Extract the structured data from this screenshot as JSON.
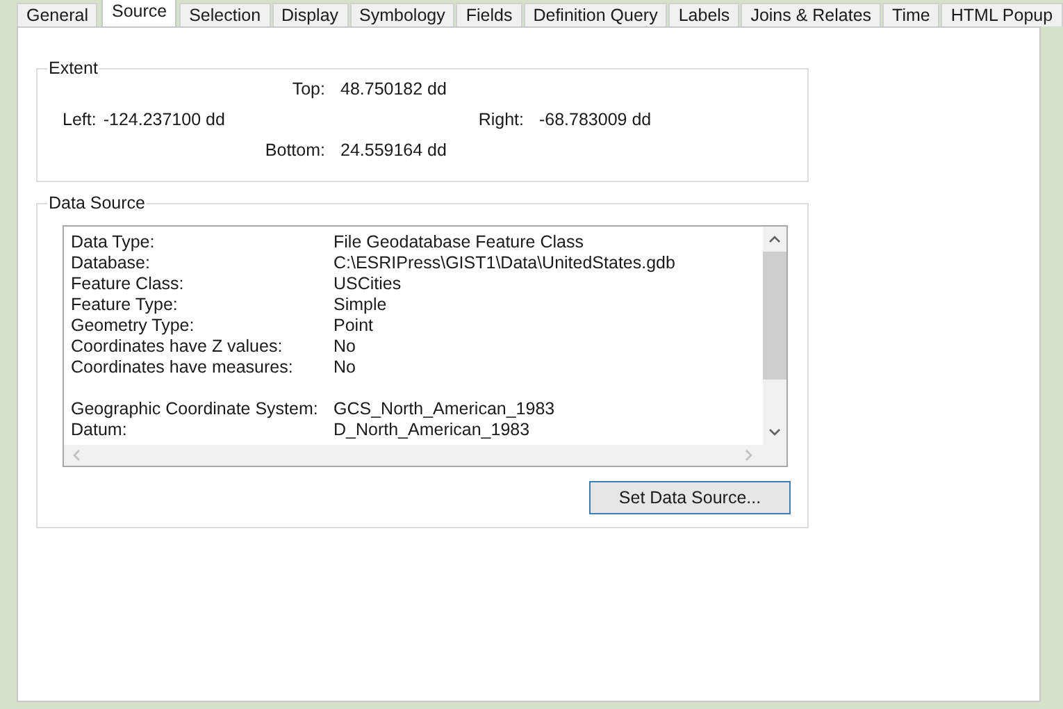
{
  "tabs": [
    {
      "label": "General",
      "selected": false
    },
    {
      "label": "Source",
      "selected": true
    },
    {
      "label": "Selection",
      "selected": false
    },
    {
      "label": "Display",
      "selected": false
    },
    {
      "label": "Symbology",
      "selected": false
    },
    {
      "label": "Fields",
      "selected": false
    },
    {
      "label": "Definition Query",
      "selected": false
    },
    {
      "label": "Labels",
      "selected": false
    },
    {
      "label": "Joins & Relates",
      "selected": false
    },
    {
      "label": "Time",
      "selected": false
    },
    {
      "label": "HTML Popup",
      "selected": false
    }
  ],
  "extent": {
    "title": "Extent",
    "top": {
      "label": "Top:",
      "value": "48.750182 dd"
    },
    "left": {
      "label": "Left:",
      "value": "-124.237100 dd"
    },
    "right": {
      "label": "Right:",
      "value": "-68.783009 dd"
    },
    "bottom": {
      "label": "Bottom:",
      "value": "24.559164 dd"
    }
  },
  "data_source": {
    "title": "Data Source",
    "sections": [
      [
        {
          "label": "Data Type:",
          "value": "File Geodatabase Feature Class"
        },
        {
          "label": "Database:",
          "value": "C:\\ESRIPress\\GIST1\\Data\\UnitedStates.gdb"
        },
        {
          "label": "Feature Class:",
          "value": "USCities"
        },
        {
          "label": "Feature Type:",
          "value": "Simple"
        },
        {
          "label": "Geometry Type:",
          "value": "Point"
        },
        {
          "label": "Coordinates have Z values:",
          "value": "No"
        },
        {
          "label": "Coordinates have measures:",
          "value": "No"
        }
      ],
      [
        {
          "label": "Geographic Coordinate System:",
          "value": "GCS_North_American_1983"
        },
        {
          "label": "Datum:",
          "value": "D_North_American_1983"
        }
      ]
    ],
    "button": "Set Data Source..."
  }
}
